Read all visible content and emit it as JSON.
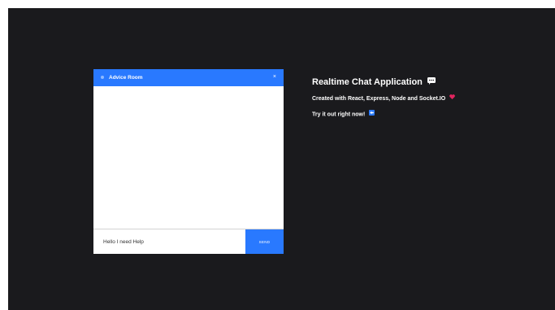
{
  "chat": {
    "room_name": "Advice Room",
    "close_symbol": "×",
    "input_value": "Hello I need Help",
    "send_label": "SEND"
  },
  "info": {
    "title": "Realtime Chat Application",
    "subtitle": "Created with React, Express, Node and Socket.IO",
    "cta": "Try it out right now!"
  },
  "icons": {
    "title_icon": "speech-balloon-icon",
    "subtitle_icon": "heart-icon",
    "cta_icon": "left-arrow-icon"
  },
  "colors": {
    "background": "#1a1a1d",
    "accent": "#2979ff",
    "heart": "#e0245e"
  }
}
